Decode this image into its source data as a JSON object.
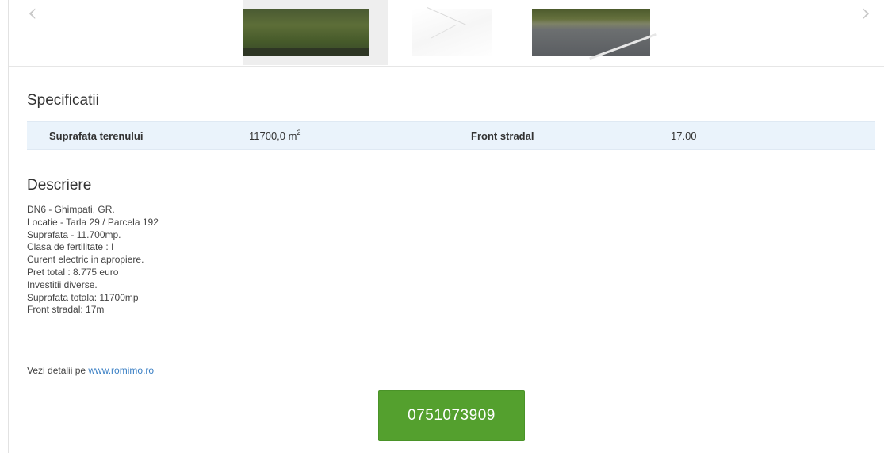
{
  "carousel": {
    "prev_glyph": "‹",
    "next_glyph": "›",
    "thumbnails": [
      "land-photo-field",
      "land-plan-sketch",
      "land-photo-road"
    ]
  },
  "specs": {
    "title": "Specificatii",
    "items": [
      {
        "label": "Suprafata terenului",
        "value": "11700,0 m",
        "unit_sup": "2"
      },
      {
        "label": "Front stradal",
        "value": "17.00"
      }
    ]
  },
  "description": {
    "title": "Descriere",
    "lines": [
      "DN6 - Ghimpati, GR.",
      "Locatie - Tarla 29 / Parcela 192",
      "Suprafata - 11.700mp.",
      "Clasa de fertilitate : I",
      "Curent electric in apropiere.",
      "Pret total : 8.775 euro",
      "Investitii diverse.",
      "Suprafata totala: 11700mp",
      "Front stradal: 17m"
    ],
    "more_prefix": "Vezi detalii pe ",
    "more_link": "www.romimo.ro"
  },
  "contact": {
    "phone": "0751073909",
    "button_color": "#54a02e"
  },
  "colors": {
    "spec_row_bg": "#eaf3fb",
    "link": "#3a7fc4"
  }
}
